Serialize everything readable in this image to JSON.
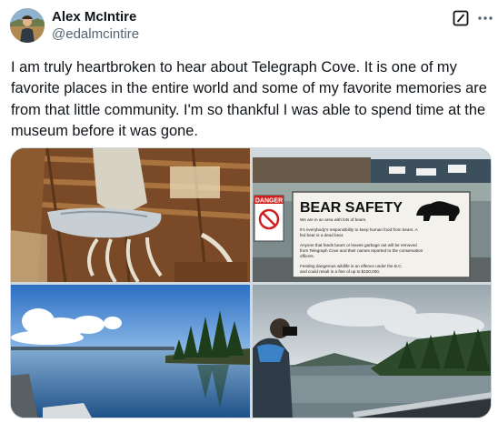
{
  "author": {
    "name": "Alex McIntire",
    "handle": "@edalmcintire",
    "avatar_icon": "profile-photo"
  },
  "actions": {
    "grok_icon": "grok-icon",
    "more_icon": "more-options-icon"
  },
  "tweet": {
    "lines": [
      "I am truly heartbroken to hear about Telegraph Cove. It is one of my",
      "favorite places in the entire world and some of my favorite memories are",
      "from that little community. I'm so thankful I was able to spend time at the",
      "museum before it was gone."
    ]
  },
  "media": {
    "sign": {
      "warning_label": "DANGER",
      "title": "BEAR SAFETY",
      "lines": [
        "We are in an area with lots of bears.",
        "It's everybody's responsibility to keep human food from bears. A",
        "fed bear is a dead bear.",
        "Anyone that feeds bears or leaves garbage out will be removed",
        "from Telegraph Cove and their names reported to the conservation",
        "officers.",
        "Feeding dangerous wildlife is an offence under the B.C.",
        "and could result in a fine of up to $100,000."
      ]
    }
  }
}
